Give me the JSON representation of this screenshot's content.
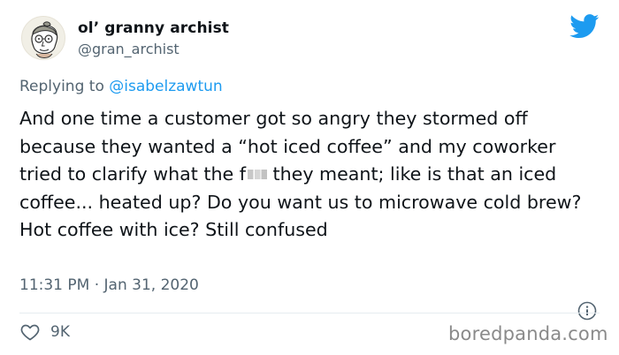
{
  "user": {
    "display_name": "ol’ granny archist",
    "handle": "@gran_archist",
    "avatar_icon": "granny-drawing-avatar"
  },
  "reply": {
    "prefix": "Replying to",
    "mention": "@isabelzawtun"
  },
  "tweet": {
    "text_before_censor": "And one time a customer got so angry they stormed off because they wanted a “hot iced coffee” and my coworker tried to clarify what the f",
    "text_after_censor": " they meant; like is that an iced coffee... heated up? Do you want us to microwave cold brew? Hot coffee with ice? Still confused",
    "timestamp": "11:31 PM · Jan 31, 2020"
  },
  "engagement": {
    "likes": "9K"
  },
  "watermark": "boredpanda.com",
  "icons": {
    "brand": "twitter-bird-icon",
    "info": "info-icon",
    "like": "heart-icon"
  },
  "colors": {
    "twitter_blue": "#1d9bf0",
    "secondary_text": "#536471",
    "primary_text": "#0f1419"
  }
}
